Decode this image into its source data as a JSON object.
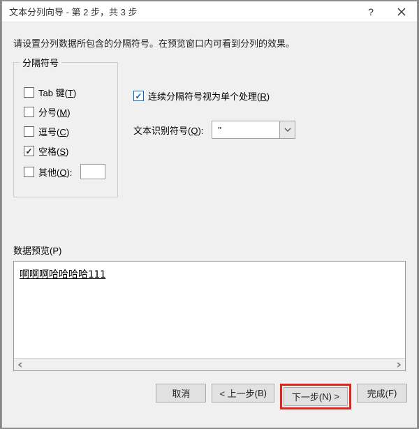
{
  "titlebar": {
    "title": "文本分列向导 - 第 2 步，共 3 步"
  },
  "instructions": "请设置分列数据所包含的分隔符号。在预览窗口内可看到分列的效果。",
  "delimiters": {
    "legend": "分隔符号",
    "tab": {
      "label_pre": "Tab 键(",
      "hotkey": "T",
      "label_post": ")",
      "checked": false
    },
    "semicolon": {
      "label_pre": "分号(",
      "hotkey": "M",
      "label_post": ")",
      "checked": false
    },
    "comma": {
      "label_pre": "逗号(",
      "hotkey": "C",
      "label_post": ")",
      "checked": false
    },
    "space": {
      "label_pre": "空格(",
      "hotkey": "S",
      "label_post": ")",
      "checked": true
    },
    "other": {
      "label_pre": "其他(",
      "hotkey": "O",
      "label_post": "):",
      "checked": false,
      "value": ""
    }
  },
  "consecutive": {
    "label_pre": "连续分隔符号视为单个处理(",
    "hotkey": "R",
    "label_post": ")",
    "checked": true
  },
  "text_qualifier": {
    "label_pre": "文本识别符号(",
    "hotkey": "Q",
    "label_post": "):",
    "value": "\""
  },
  "preview": {
    "label_pre": "数据预览(",
    "hotkey": "P",
    "label_post": ")",
    "rows": [
      "啊啊啊哈哈哈哈111"
    ]
  },
  "buttons": {
    "cancel": "取消",
    "back_pre": "< 上一步(",
    "back_hotkey": "B",
    "back_post": ")",
    "next_pre": "下一步(",
    "next_hotkey": "N",
    "next_post": ") >",
    "finish_pre": "完成(",
    "finish_hotkey": "F",
    "finish_post": ")"
  }
}
